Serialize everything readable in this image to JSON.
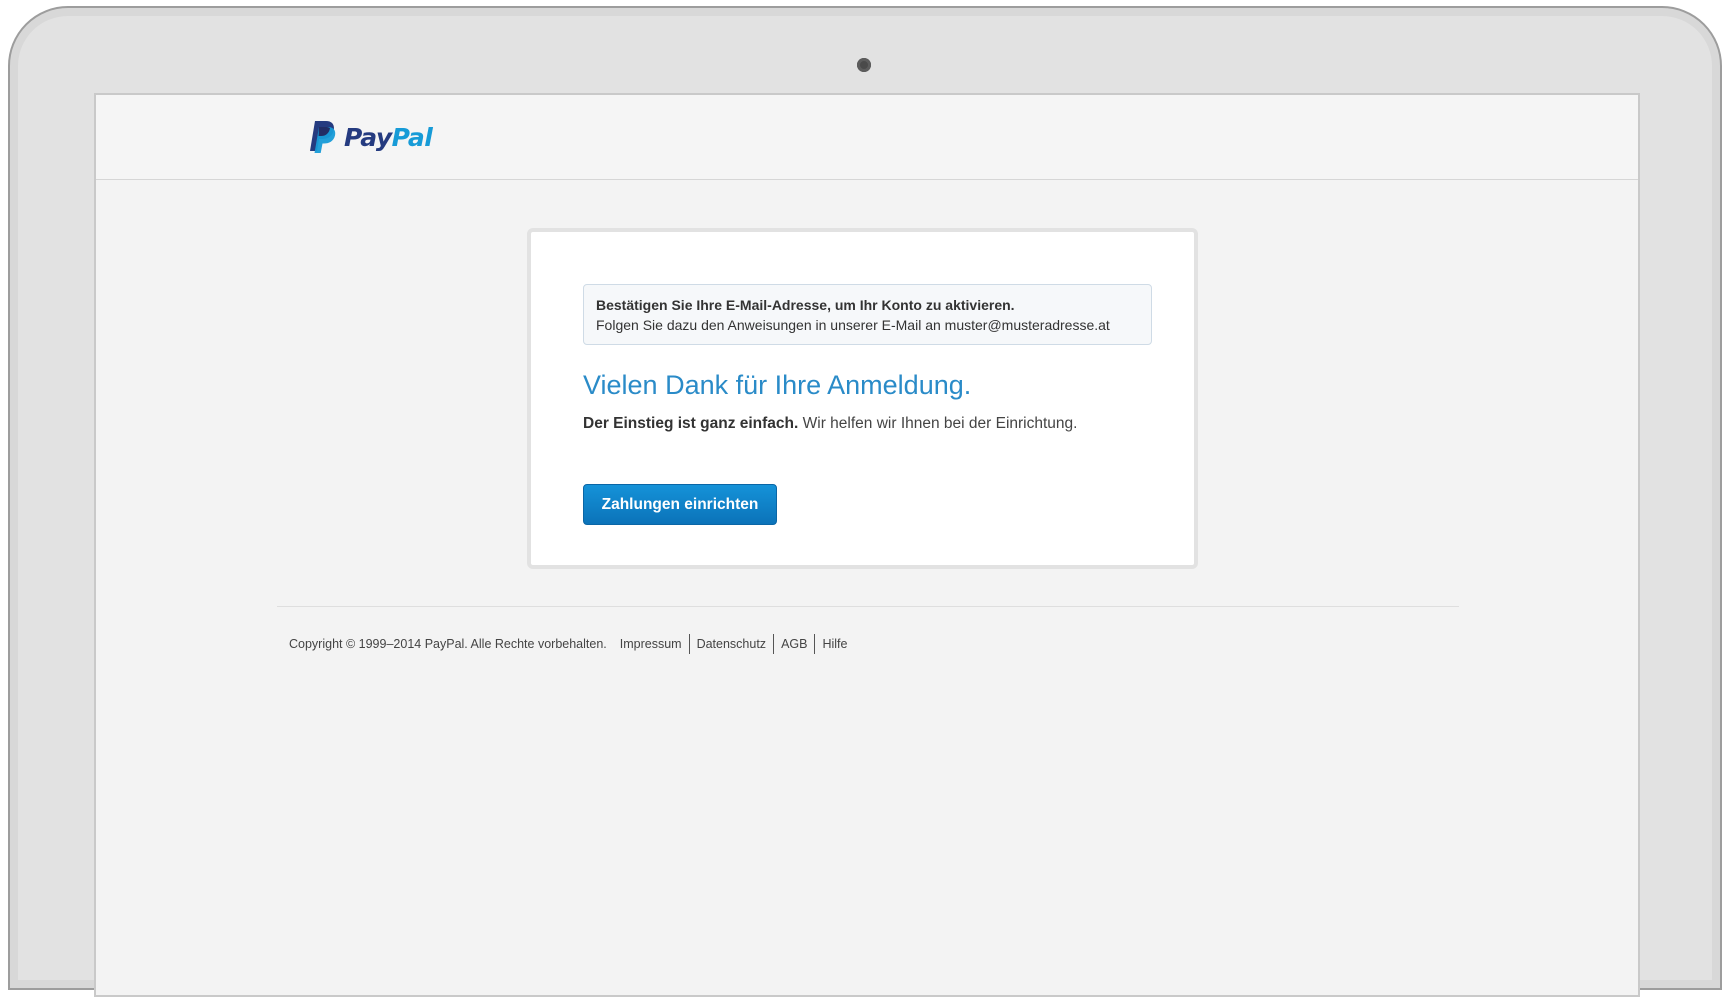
{
  "brand": {
    "logo_text_pay": "Pay",
    "logo_text_pal": "Pal",
    "logo_icon": "paypal-p-icon",
    "primary_color": "#253b80",
    "accent_color": "#179bd7"
  },
  "notice": {
    "title": "Bestätigen Sie Ihre E-Mail-Adresse, um Ihr Konto zu aktivieren.",
    "body": "Folgen Sie dazu den Anweisungen in unserer E-Mail an muster@musteradresse.at"
  },
  "main": {
    "heading": "Vielen Dank für Ihre Anmeldung.",
    "subline_bold": "Der Einstieg ist ganz einfach.",
    "subline_rest": " Wir helfen wir Ihnen bei der Einrichtung.",
    "cta_label": "Zahlungen einrichten",
    "cta_color": "#0f83cc"
  },
  "footer": {
    "copyright": "Copyright © 1999–2014 PayPal. Alle Rechte vorbehalten.",
    "links": [
      "Impressum",
      "Datenschutz",
      "AGB",
      "Hilfe"
    ]
  }
}
